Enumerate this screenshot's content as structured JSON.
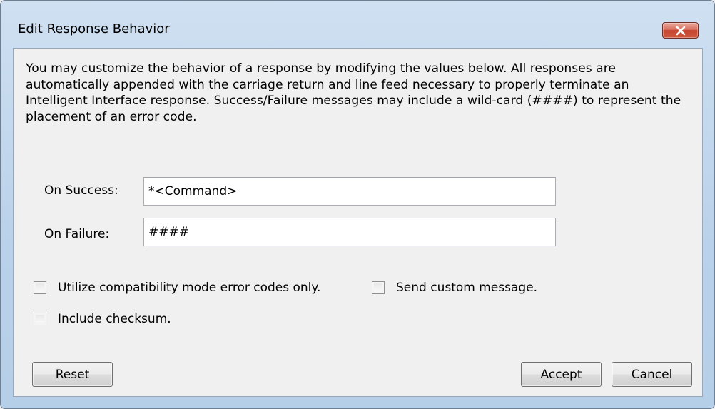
{
  "window": {
    "title": "Edit Response Behavior",
    "close_icon": "close-x-icon"
  },
  "description": "You may customize the behavior of a response by modifying the values below. All responses are automatically appended with the carriage return and line feed necessary to properly terminate an Intelligent Interface response. Success/Failure messages may include a wild-card (####) to represent the placement of an error code.",
  "fields": {
    "on_success": {
      "label": "On Success:",
      "value": "*<Command>"
    },
    "on_failure": {
      "label": "On Failure:",
      "value": "####"
    }
  },
  "options": {
    "compatibility_mode": {
      "label": "Utilize compatibility mode error codes only.",
      "checked": false
    },
    "send_custom_message": {
      "label": "Send custom message.",
      "checked": false
    },
    "include_checksum": {
      "label": "Include checksum.",
      "checked": false
    }
  },
  "buttons": {
    "reset": "Reset",
    "accept": "Accept",
    "cancel": "Cancel"
  },
  "colors": {
    "frame": "#b9d1ea",
    "close_button": "#c4432f",
    "client_background": "#f0f0f0"
  }
}
